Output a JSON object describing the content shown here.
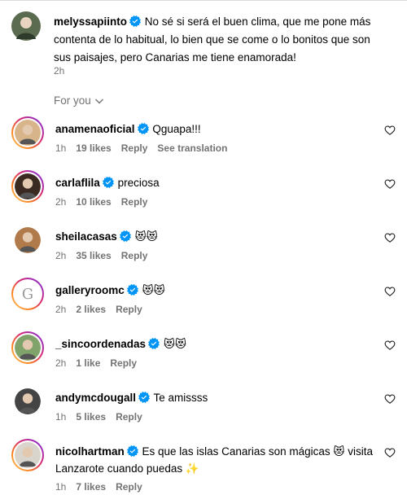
{
  "caption": {
    "username": "melyssapiinto",
    "text": "No sé si será el buen clima, que me pone más contenta de lo habitual, lo bien que se come o lo bonitos que son sus paisajes, pero Canarias me tiene enamorada!",
    "time": "2h"
  },
  "filter": {
    "label": "For you"
  },
  "actions": {
    "reply": "Reply",
    "see_translation": "See translation"
  },
  "comments": [
    {
      "username": "anamenaoficial",
      "verified": true,
      "text": "Qguapa!!!",
      "time": "1h",
      "likes": "19 likes",
      "ring": "story",
      "avatar_color": "#d8b48a"
    },
    {
      "username": "carlaflila",
      "verified": true,
      "text": "preciosa",
      "time": "2h",
      "likes": "10 likes",
      "ring": "story",
      "avatar_color": "#3b2a22"
    },
    {
      "username": "sheilacasas",
      "verified": true,
      "text": "😻😻",
      "time": "2h",
      "likes": "35 likes",
      "ring": "none",
      "avatar_color": "#b07a4a"
    },
    {
      "username": "galleryroomc",
      "verified": true,
      "text": "😻😻",
      "time": "2h",
      "likes": "2 likes",
      "ring": "story",
      "avatar_color": "#ffffff"
    },
    {
      "username": "_sincoordenadas",
      "verified": true,
      "text": "😻😻",
      "time": "2h",
      "likes": "1 like",
      "ring": "story",
      "avatar_color": "#7fa36b"
    },
    {
      "username": "andymcdougall",
      "verified": true,
      "text": "Te amissss",
      "time": "1h",
      "likes": "5 likes",
      "ring": "none",
      "avatar_color": "#444444"
    },
    {
      "username": "nicolhartman",
      "verified": true,
      "text": "Es que las islas Canarias son mágicas 😻 visita Lanzarote cuando puedas ✨",
      "time": "1h",
      "likes": "7 likes",
      "ring": "story",
      "avatar_color": "#d9d4cc"
    }
  ],
  "colors": {
    "verified": "#0095f6",
    "muted": "#737373"
  }
}
